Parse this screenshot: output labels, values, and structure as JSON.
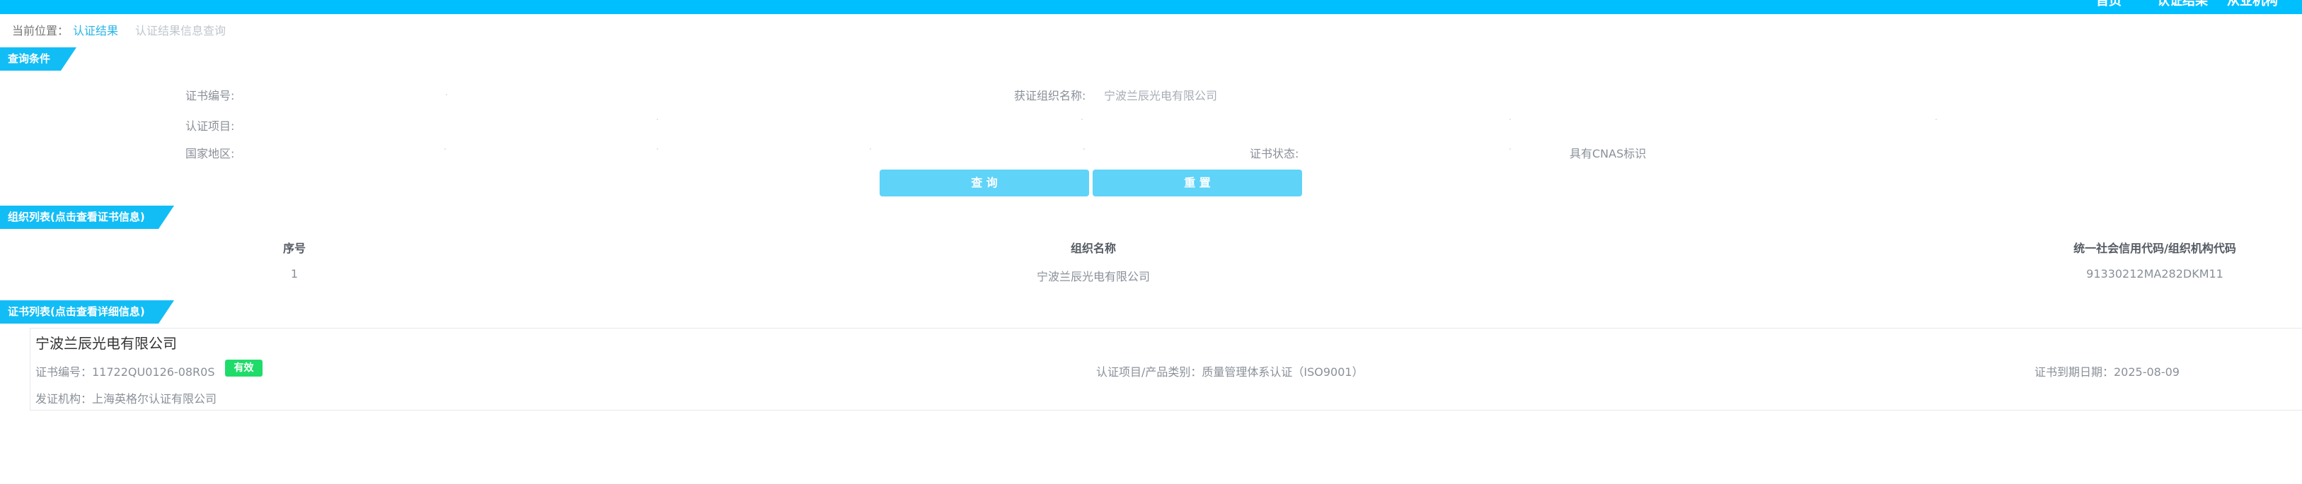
{
  "topnav": {
    "items": [
      "首页",
      "认证结果",
      "从业机构"
    ]
  },
  "breadcrumb": {
    "prefix": "当前位置：",
    "current": "认证结果",
    "sub": "认证结果信息查询"
  },
  "query": {
    "section_title": "查询条件",
    "cert_no_label": "证书编号:",
    "org_name_label": "获证组织名称:",
    "org_name_value": "宁波兰辰光电有限公司",
    "project_label": "认证项目:",
    "region_label": "国家地区:",
    "status_label": "证书状态:",
    "cnas_label": "具有CNAS标识",
    "search_button": "查 询",
    "reset_button": "重 置"
  },
  "org_list": {
    "section_title": "组织列表(点击查看证书信息)",
    "columns": [
      "序号",
      "组织名称",
      "统一社会信用代码/组织机构代码"
    ],
    "rows": [
      [
        "1",
        "宁波兰辰光电有限公司",
        "91330212MA282DKM11"
      ]
    ]
  },
  "cert_list": {
    "section_title": "证书列表(点击查看详细信息)",
    "items": [
      {
        "org_name": "宁波兰辰光电有限公司",
        "cert_no": "证书编号：11722QU0126-08R0S",
        "status": "有效",
        "project": "认证项目/产品类别：质量管理体系认证（ISO9001）",
        "expiry": "证书到期日期：2025-08-09",
        "issuer": "发证机构：上海英格尔认证有限公司"
      }
    ]
  },
  "colors": {
    "topbar": "#00bfff",
    "section_tag": "#12bdf6",
    "button": "#5fd3f8",
    "badge": "#1fdc6a",
    "link": "#26b4e8"
  }
}
